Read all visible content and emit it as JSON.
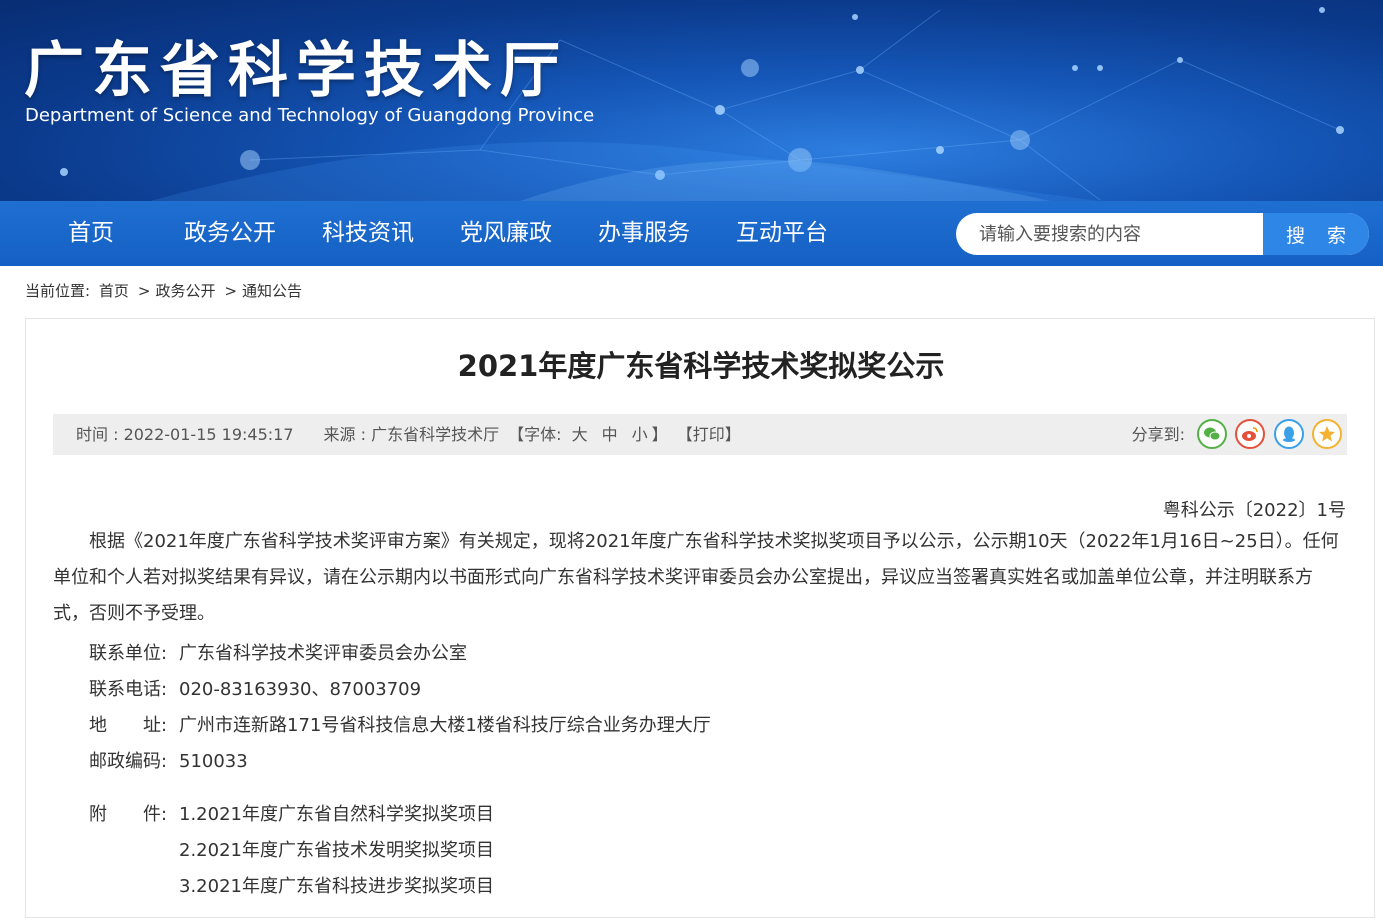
{
  "header": {
    "title": "广东省科学技术厅",
    "subtitle": "Department of Science and Technology of Guangdong Province"
  },
  "nav": {
    "items": [
      {
        "label": "首页"
      },
      {
        "label": "政务公开"
      },
      {
        "label": "科技资讯"
      },
      {
        "label": "党风廉政"
      },
      {
        "label": "办事服务"
      },
      {
        "label": "互动平台"
      }
    ],
    "search_placeholder": "请输入要搜索的内容",
    "search_button": "搜 索"
  },
  "breadcrumb": {
    "prefix": "当前位置:",
    "items": [
      "首页",
      "政务公开",
      "通知公告"
    ],
    "separator": ">"
  },
  "article": {
    "title": "2021年度广东省科学技术奖拟奖公示",
    "meta": {
      "time": "时间 : 2022-01-15 19:45:17",
      "source": "来源 : 广东省科学技术厅",
      "font_prefix": "【字体:",
      "font_large": "大",
      "font_medium": "中",
      "font_small": "小",
      "font_suffix": "】",
      "print": "【打印】",
      "share_label": "分享到:"
    },
    "share_icons": [
      "wechat-icon",
      "weibo-icon",
      "qq-icon",
      "qzone-icon"
    ],
    "doc_no": "粤科公示〔2022〕1号",
    "body": "根据《2021年度广东省科学技术奖评审方案》有关规定，现将2021年度广东省科学技术奖拟奖项目予以公示，公示期10天（2022年1月16日~25日）。任何单位和个人若对拟奖结果有异议，请在公示期内以书面形式向广东省科学技术奖评审委员会办公室提出，异议应当签署真实姓名或加盖单位公章，并注明联系方式，否则不予受理。",
    "contact": [
      {
        "key": "联系单位:",
        "value": "广东省科学技术奖评审委员会办公室"
      },
      {
        "key": "联系电话:",
        "value": "020-83163930、87003709"
      },
      {
        "key": "地　　址:",
        "value": "广州市连新路171号省科技信息大楼1楼省科技厅综合业务办理大厅"
      },
      {
        "key": "邮政编码:",
        "value": "510033"
      }
    ],
    "attachments_label": "附　　件:",
    "attachments": [
      "1.2021年度广东省自然科学奖拟奖项目",
      "2.2021年度广东省技术发明奖拟奖项目",
      "3.2021年度广东省科技进步奖拟奖项目"
    ]
  },
  "colors": {
    "banner_dark": "#082d73",
    "nav_blue": "#1560c4",
    "search_button": "#2e86e6",
    "meta_bg": "#eeeeee"
  }
}
